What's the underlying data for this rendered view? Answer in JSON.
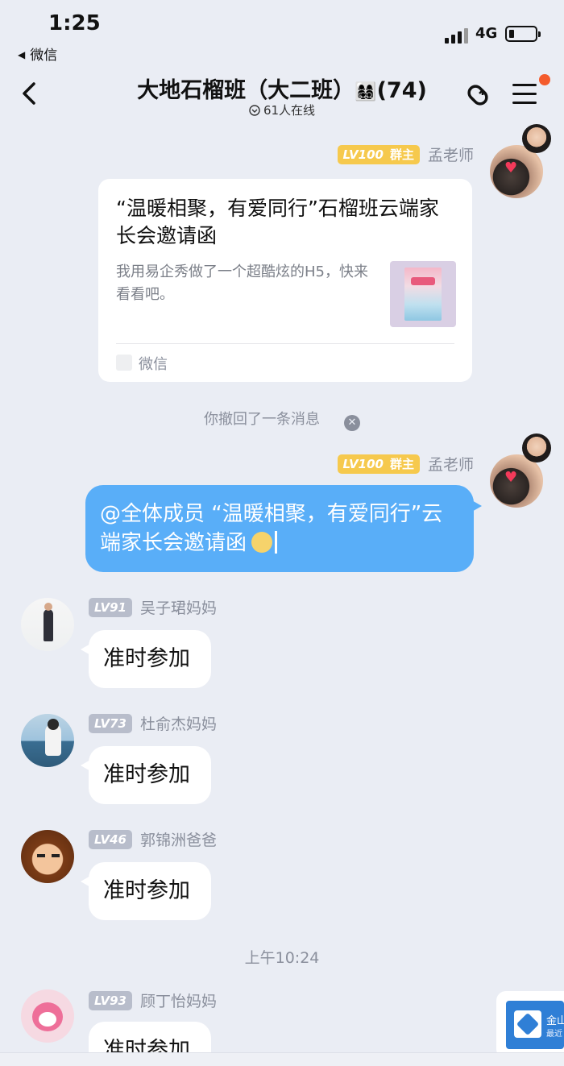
{
  "status_bar": {
    "time": "1:25",
    "back_app": "微信",
    "network": "4G"
  },
  "header": {
    "title": "大地石榴班（大二班）",
    "title_emoji": "👩‍👩‍👧‍👦",
    "member_count": "(74)",
    "online": "61人在线"
  },
  "messages": {
    "m1": {
      "level": "LV100",
      "role": "群主",
      "sender": "孟老师",
      "card_title": "“温暖相聚，有爱同行”石榴班云端家长会邀请函",
      "card_desc": "我用易企秀做了一个超酷炫的H5，快来看看吧。",
      "card_source": "微信"
    },
    "recall_note": "你撤回了一条消息",
    "m2": {
      "level": "LV100",
      "role": "群主",
      "sender": "孟老师",
      "text": "@全体成员 “温暖相聚，有爱同行”云端家长会邀请函"
    },
    "m3": {
      "level": "LV91",
      "sender": "吴子珺妈妈",
      "text": "准时参加"
    },
    "m4": {
      "level": "LV73",
      "sender": "杜俞杰妈妈",
      "text": "准时参加"
    },
    "m5": {
      "level": "LV46",
      "sender": "郭锦洲爸爸",
      "text": "准时参加"
    },
    "time_separator": "上午10:24",
    "m6": {
      "level": "LV93",
      "sender": "顾丁怡妈妈",
      "text": "准时参加"
    }
  },
  "floating_tile": {
    "line1": "金山",
    "line2": "最近"
  },
  "colors": {
    "background": "#eaedf4",
    "self_bubble": "#59aef8",
    "owner_badge": "#f6c94d",
    "member_badge": "#b8bdcb",
    "notification_dot": "#f45b2c"
  },
  "icons": [
    "back-arrow-icon",
    "share-link-icon",
    "menu-icon",
    "online-indicator-icon",
    "dismiss-icon"
  ]
}
